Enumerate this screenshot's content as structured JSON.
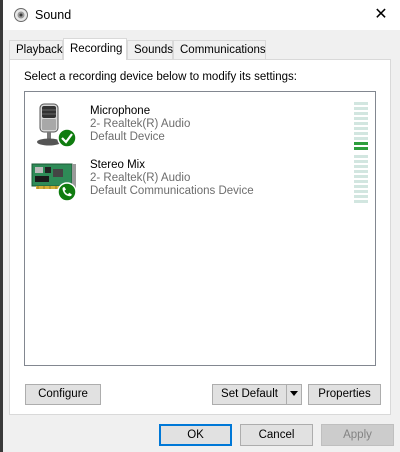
{
  "window": {
    "title": "Sound"
  },
  "tabs": [
    {
      "label": "Playback"
    },
    {
      "label": "Recording"
    },
    {
      "label": "Sounds"
    },
    {
      "label": "Communications"
    }
  ],
  "active_tab": "Recording",
  "instruction": "Select a recording device below to modify its settings:",
  "devices": [
    {
      "name": "Microphone",
      "driver": "2- Realtek(R) Audio",
      "status": "Default Device",
      "level_fraction": 0.2,
      "icon": "microphone-icon",
      "badge": "checkmark-badge-icon"
    },
    {
      "name": "Stereo Mix",
      "driver": "2- Realtek(R) Audio",
      "status": "Default Communications Device",
      "level_fraction": 0.0,
      "icon": "sound-card-icon",
      "badge": "phone-badge-icon"
    }
  ],
  "buttons": {
    "configure": "Configure",
    "set_default": "Set Default",
    "properties": "Properties",
    "ok": "OK",
    "cancel": "Cancel",
    "apply": "Apply"
  },
  "colors": {
    "accent": "#0078d7",
    "meter_on": "#2e9e3c",
    "meter_off": "#d2e6e0",
    "badge_green": "#107c10"
  }
}
